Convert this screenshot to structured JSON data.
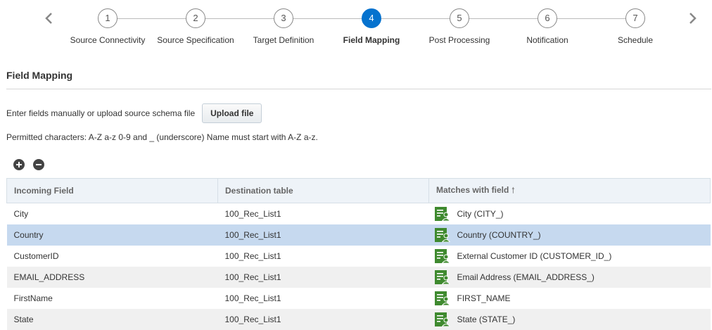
{
  "wizard": {
    "steps": [
      {
        "number": "1",
        "label": "Source Connectivity"
      },
      {
        "number": "2",
        "label": "Source Specification"
      },
      {
        "number": "3",
        "label": "Target Definition"
      },
      {
        "number": "4",
        "label": "Field Mapping"
      },
      {
        "number": "5",
        "label": "Post Processing"
      },
      {
        "number": "6",
        "label": "Notification"
      },
      {
        "number": "7",
        "label": "Schedule"
      }
    ],
    "active_step": "4",
    "active_color": "#0572ce"
  },
  "section": {
    "title": "Field Mapping",
    "upload_text": "Enter fields manually or upload source schema file",
    "upload_button": "Upload file",
    "permitted_text": "Permitted characters: A-Z a-z 0-9 and _ (underscore) Name must start with A-Z a-z."
  },
  "toolbar": {
    "add_icon": "plus-circle-icon",
    "remove_icon": "minus-circle-icon"
  },
  "table": {
    "headers": [
      "Incoming Field",
      "Destination table",
      "Matches with field"
    ],
    "sort_icon": "sort-ascending-icon",
    "rows": [
      {
        "incoming": "City",
        "destination": "100_Rec_List1",
        "match": "City (CITY_)"
      },
      {
        "incoming": "Country",
        "destination": "100_Rec_List1",
        "match": "Country (COUNTRY_)"
      },
      {
        "incoming": "CustomerID",
        "destination": "100_Rec_List1",
        "match": "External Customer ID (CUSTOMER_ID_)"
      },
      {
        "incoming": "EMAIL_ADDRESS",
        "destination": "100_Rec_List1",
        "match": "Email Address (EMAIL_ADDRESS_)"
      },
      {
        "incoming": "FirstName",
        "destination": "100_Rec_List1",
        "match": "FIRST_NAME"
      },
      {
        "incoming": "State",
        "destination": "100_Rec_List1",
        "match": "State (STATE_)"
      }
    ],
    "selected_row": 1,
    "field_icon": "profile-field-icon",
    "field_icon_color": "#3f8a2f",
    "selected_color": "#c6d9ef"
  }
}
